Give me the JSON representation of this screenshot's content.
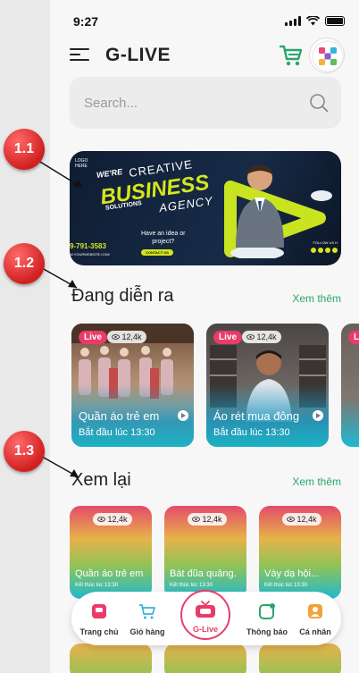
{
  "status": {
    "time": "9:27"
  },
  "header": {
    "title": "G-LIVE"
  },
  "search": {
    "placeholder": "Search..."
  },
  "banner": {
    "logo": "LOGO\nHERE",
    "we_re": "WE'RE",
    "creative": "CREATIVE",
    "business": "BUSINESS",
    "solutions": "SOLUTIONS",
    "agency": "AGENCY",
    "idea": "Have an idea or\nproject?",
    "contact": "CONTACT US",
    "phone": "9-791-3583",
    "website": "W.YOURWEBSITE.COM",
    "follow": "FOLLOW US H"
  },
  "callouts": [
    "1.1",
    "1.2",
    "1.3"
  ],
  "live": {
    "title": "Đang diễn ra",
    "more": "Xem thêm",
    "items": [
      {
        "badge": "Live",
        "views": "12,4k",
        "title": "Quần áo trẻ em",
        "sub": "Bắt đầu lúc 13:30"
      },
      {
        "badge": "Live",
        "views": "12,4k",
        "title": "Áo rét mua đông",
        "sub": "Bắt đầu lúc 13:30"
      },
      {
        "badge": "Live",
        "views": "",
        "title": "",
        "sub": ""
      }
    ]
  },
  "replay": {
    "title": "Xem lại",
    "more": "Xem thêm",
    "items": [
      {
        "views": "12,4k",
        "title": "Quần áo trẻ em",
        "sub": "Kết thúc lúc 13:30"
      },
      {
        "views": "12,4k",
        "title": "Bát đũa quảng.",
        "sub": "Kết thúc lúc 13:30"
      },
      {
        "views": "12,4k",
        "title": "Váy dạ hội...",
        "sub": "Kết thúc lúc 13:30"
      }
    ]
  },
  "nav": {
    "home": "Trang chủ",
    "cart": "Giỏ hàng",
    "glive": "G-Live",
    "notify": "Thông báo",
    "profile": "Cá nhân"
  },
  "colors": {
    "accent_green": "#2aa66b",
    "accent_pink": "#ea3b6a",
    "banner_lime": "#d6e51c"
  }
}
